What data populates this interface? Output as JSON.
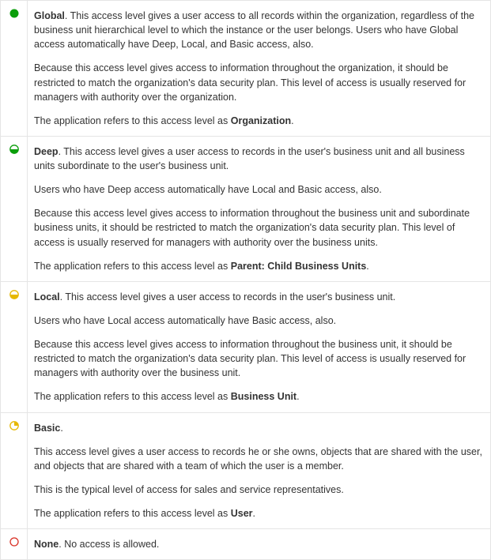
{
  "levels": [
    {
      "icon": "global",
      "name": "Global",
      "p1": ". This access level gives a user access to all records within the organization, regardless of the business unit hierarchical level to which the instance or the user belongs. Users who have Global access automatically have Deep, Local, and Basic access, also.",
      "p2": "Because this access level gives access to information throughout the organization, it should be restricted to match the organization's data security plan. This level of access is usually reserved for managers with authority over the organization.",
      "ref_prefix": "The application refers to this access level as ",
      "ref_bold": "Organization",
      "ref_suffix": "."
    },
    {
      "icon": "deep",
      "name": "Deep",
      "p1": ". This access level gives a user access to records in the user's business unit and all business units subordinate to the user's business unit.",
      "p2": "Users who have Deep access automatically have Local and Basic access, also.",
      "p3": "Because this access level gives access to information throughout the business unit and subordinate business units, it should be restricted to match the organization's data security plan. This level of access is usually reserved for managers with authority over the business units.",
      "ref_prefix": "The application refers to this access level as ",
      "ref_bold": "Parent: Child Business Units",
      "ref_suffix": "."
    },
    {
      "icon": "local",
      "name": "Local",
      "p1": ". This access level gives a user access to records in the user's business unit.",
      "p2": "Users who have Local access automatically have Basic access, also.",
      "p3": "Because this access level gives access to information throughout the business unit, it should be restricted to match the organization's data security plan. This level of access is usually reserved for managers with authority over the business unit.",
      "ref_prefix": "The application refers to this access level as ",
      "ref_bold": "Business Unit",
      "ref_suffix": "."
    },
    {
      "icon": "basic",
      "name": "Basic",
      "p1": ".",
      "p2": "This access level gives a user access to records he or she owns, objects that are shared with the user, and objects that are shared with a team of which the user is a member.",
      "p3": "This is the typical level of access for sales and service representatives.",
      "ref_prefix": "The application refers to this access level as ",
      "ref_bold": "User",
      "ref_suffix": "."
    },
    {
      "icon": "none",
      "name": "None",
      "p1": ". No access is allowed."
    }
  ]
}
